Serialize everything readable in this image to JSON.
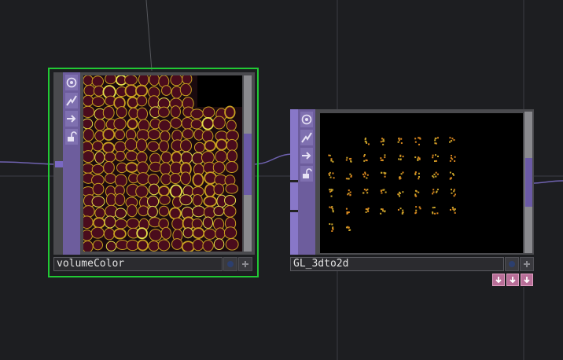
{
  "nodes": {
    "volume_color": {
      "name": "volumeColor",
      "tool_icons": [
        "viewer-icon",
        "cook-icon",
        "bypass-icon",
        "lock-icon"
      ],
      "state": "selected"
    },
    "gl_3dto2d": {
      "name": "GL_3dto2d",
      "tool_icons": [
        "viewer-icon",
        "cook-icon",
        "bypass-icon",
        "lock-icon"
      ],
      "flag_icons": [
        "down-arrow-icon",
        "down-arrow-icon",
        "down-arrow-icon"
      ]
    }
  },
  "colors": {
    "background": "#1d1e21",
    "selection": "#21c934",
    "node_purple": "#6d5d9d",
    "cell_outline": "#c8a020",
    "cell_fill": "#4a0c1c",
    "flag_pink": "#b86e98"
  }
}
